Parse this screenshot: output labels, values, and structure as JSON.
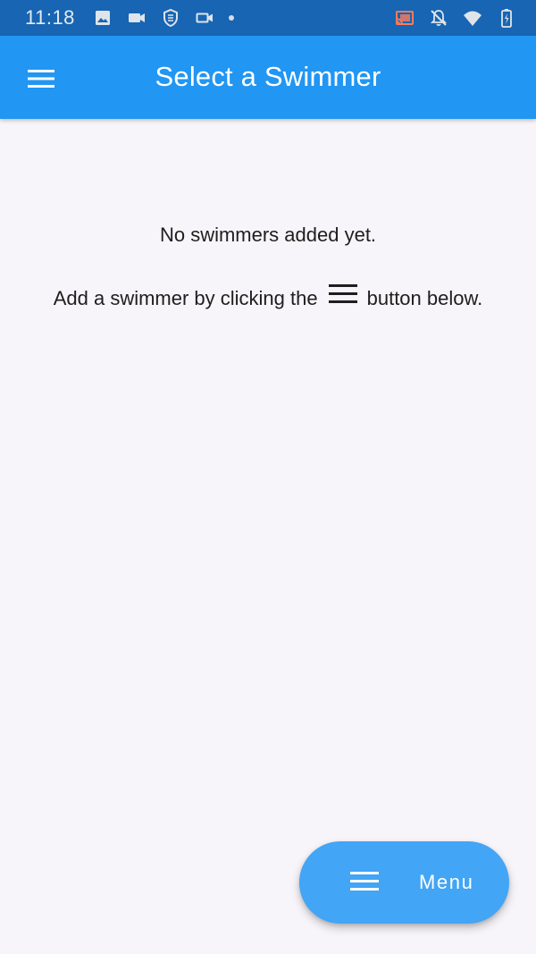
{
  "status_bar": {
    "time": "11:18",
    "left_icons": [
      "gallery-icon",
      "video-icon",
      "shield-icon",
      "camera-icon"
    ],
    "right_icons": [
      "cast-icon",
      "notifications-off-icon",
      "wifi-icon",
      "battery-icon"
    ]
  },
  "app_bar": {
    "title": "Select a Swimmer",
    "menu_icon": "hamburger-icon",
    "background": "#2196f3"
  },
  "main": {
    "empty_message": "No swimmers added yet.",
    "hint_before": "Add a swimmer by clicking the",
    "hint_icon": "hamburger-icon",
    "hint_after": "button below."
  },
  "fab": {
    "icon": "hamburger-icon",
    "label": "Menu",
    "background": "#42a5f5"
  }
}
